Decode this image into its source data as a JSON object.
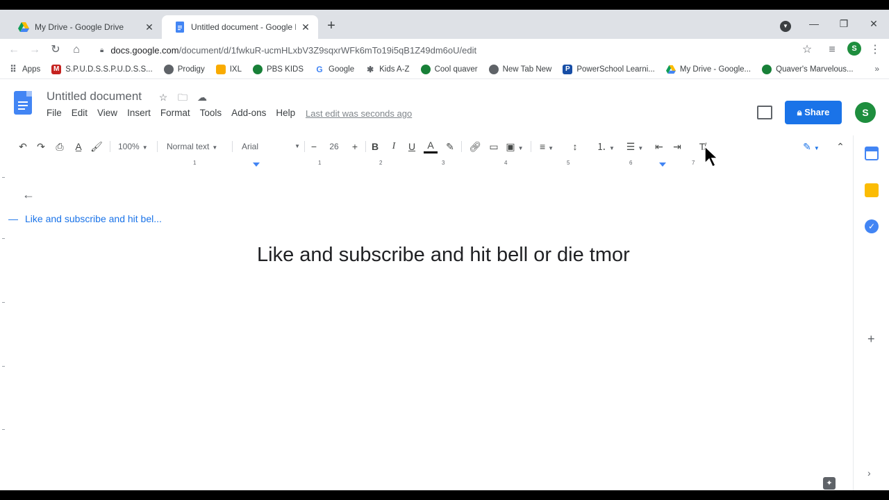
{
  "browser": {
    "tabs": [
      {
        "title": "My Drive - Google Drive",
        "favicon": "google-drive-icon"
      },
      {
        "title": "Untitled document - Google Do",
        "favicon": "google-docs-icon"
      }
    ],
    "new_tab_symbol": "+",
    "url_host": "docs.google.com",
    "url_path": "/document/d/1fwkuR-ucmHLxbV3Z9sqxrWFk6mTo19i5qB1Z49dm6oU/edit",
    "profile_initial": "S"
  },
  "bookmarks": [
    {
      "label": "Apps",
      "icon": "apps-grid-icon",
      "color": "#5f6368"
    },
    {
      "label": "S.P.U.D.S.S.P.U.D.S.S...",
      "icon": "bookmark-icon",
      "color": "#c5221f"
    },
    {
      "label": "Prodigy",
      "icon": "globe-icon",
      "color": "#5f6368"
    },
    {
      "label": "IXL",
      "icon": "ixl-icon",
      "color": "#f9ab00"
    },
    {
      "label": "PBS KIDS",
      "icon": "pbs-kids-icon",
      "color": "#188038"
    },
    {
      "label": "Google",
      "icon": "google-icon",
      "color": "#4285f4"
    },
    {
      "label": "Kids A-Z",
      "icon": "kids-az-icon",
      "color": "#5f6368"
    },
    {
      "label": "Cool quaver",
      "icon": "quaver-icon",
      "color": "#188038"
    },
    {
      "label": "New Tab New",
      "icon": "globe-icon",
      "color": "#5f6368"
    },
    {
      "label": "PowerSchool Learni...",
      "icon": "powerschool-icon",
      "color": "#174ea6"
    },
    {
      "label": "My Drive - Google...",
      "icon": "google-drive-icon",
      "color": "#f9ab00"
    },
    {
      "label": "Quaver's Marvelous...",
      "icon": "quaver-icon",
      "color": "#188038"
    }
  ],
  "bookmarks_overflow": "»",
  "docs": {
    "title": "Untitled document",
    "menu": [
      "File",
      "Edit",
      "View",
      "Insert",
      "Format",
      "Tools",
      "Add-ons",
      "Help"
    ],
    "last_edit": "Last edit was seconds ago",
    "share_label": "Share",
    "user_initial": "S",
    "accent": "#1a73e8"
  },
  "format_toolbar": {
    "zoom": "100%",
    "style": "Normal text",
    "font": "Arial",
    "font_size": "26"
  },
  "ruler_numbers": [
    "1",
    "1",
    "2",
    "3",
    "4",
    "5",
    "6",
    "7"
  ],
  "outline": {
    "item": "Like and subscribe and hit bel..."
  },
  "document": {
    "text": "Like and subscribe and hit bell or die tmor"
  }
}
